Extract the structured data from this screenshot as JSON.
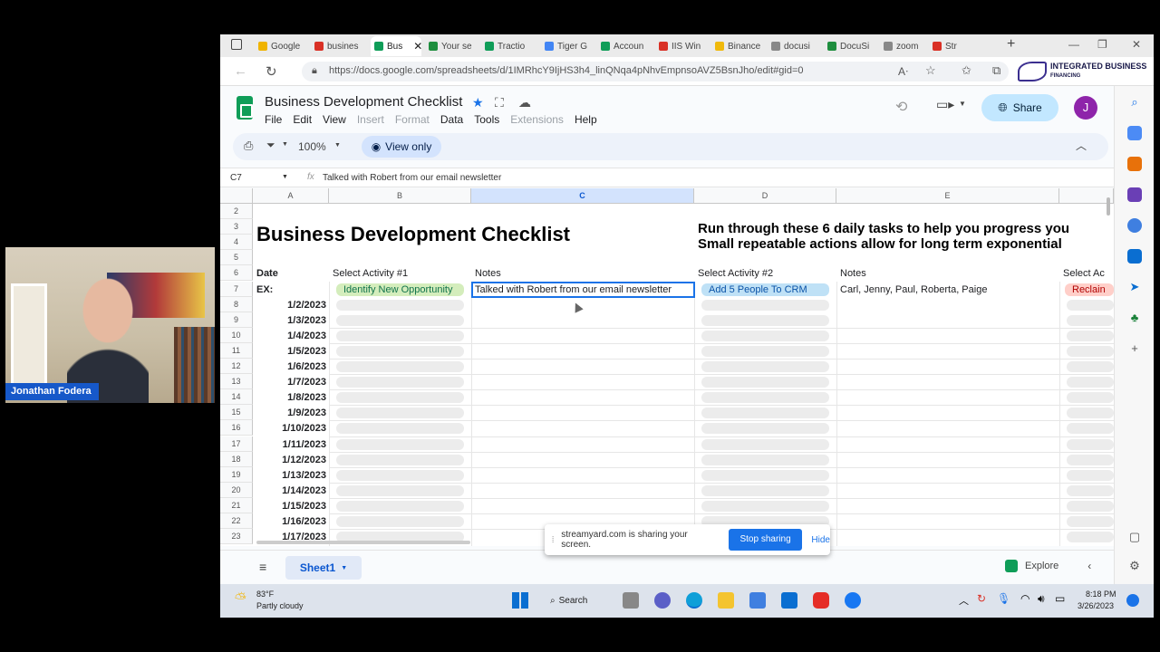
{
  "browser": {
    "tabs": [
      {
        "label": "Google",
        "color": "#f0b400"
      },
      {
        "label": "busines",
        "color": "#d93025"
      },
      {
        "label": "Bus",
        "color": "#0f9d58",
        "active": true
      },
      {
        "label": "Your se",
        "color": "#1e8e3e"
      },
      {
        "label": "Tractio",
        "color": "#0f9d58"
      },
      {
        "label": "Tiger G",
        "color": "#4285f4"
      },
      {
        "label": "Accoun",
        "color": "#0f9d58"
      },
      {
        "label": "IIS Win",
        "color": "#d93025"
      },
      {
        "label": "Binance",
        "color": "#f0b90b"
      },
      {
        "label": "docusi",
        "color": "#888888"
      },
      {
        "label": "DocuSi",
        "color": "#1e8e3e"
      },
      {
        "label": "zoom",
        "color": "#888888"
      },
      {
        "label": "Str",
        "color": "#d93025"
      }
    ],
    "url": "https://docs.google.com/spreadsheets/d/1IMRhcY9IjHS3h4_linQNqa4pNhvEmpnsoAVZ5BsnJho/edit#gid=0",
    "brand_line1": "INTEGRATED BUSINESS",
    "brand_line2": "FINANCING"
  },
  "sheets": {
    "doc_title": "Business Development Checklist",
    "menus": [
      "File",
      "Edit",
      "View",
      "Insert",
      "Format",
      "Data",
      "Tools",
      "Extensions",
      "Help"
    ],
    "share_label": "Share",
    "avatar_letter": "J",
    "zoom": "100%",
    "view_only_label": "View only",
    "cell_ref": "C7",
    "formula_icon": "fx",
    "formula_value": "Talked with Robert from our email newsletter",
    "columns": [
      "A",
      "B",
      "C",
      "D",
      "E"
    ],
    "rows": [
      "2",
      "3",
      "4",
      "5",
      "6",
      "7",
      "8",
      "9",
      "10",
      "11",
      "12",
      "13",
      "14",
      "15",
      "16",
      "17",
      "18",
      "19",
      "20",
      "21",
      "22",
      "23"
    ],
    "big_title": "Business Development Checklist",
    "tagline_1": "Run through these 6 daily tasks to help you progress you",
    "tagline_2": "Small repeatable actions allow for long term exponential",
    "header_row": {
      "date": "Date",
      "activity1": "Select Activity #1",
      "notes1": "Notes",
      "activity2": "Select Activity #2",
      "notes2": "Notes",
      "activity3": "Select Ac"
    },
    "example_row": {
      "label": "EX:",
      "activity1": "Identify New Opportunity",
      "notes1": "Talked with Robert from our email newsletter",
      "activity2": "Add 5 People To CRM",
      "notes2": "Carl, Jenny, Paul, Roberta, Paige",
      "activity3": "Reclain"
    },
    "dates": [
      "1/2/2023",
      "1/3/2023",
      "1/4/2023",
      "1/5/2023",
      "1/6/2023",
      "1/7/2023",
      "1/8/2023",
      "1/9/2023",
      "1/10/2023",
      "1/11/2023",
      "1/12/2023",
      "1/13/2023",
      "1/14/2023",
      "1/15/2023",
      "1/16/2023",
      "1/17/2023"
    ],
    "sheet_tab": "Sheet1",
    "explore_label": "Explore",
    "colors": {
      "chip_green": "#d4edbc",
      "chip_green_text": "#11734b",
      "chip_blue": "#bfe1f6",
      "chip_blue_text": "#0a53a8",
      "chip_red": "#ffcfc9",
      "chip_red_text": "#b10202"
    }
  },
  "share_popup": {
    "message": "streamyard.com is sharing your screen.",
    "stop_label": "Stop sharing",
    "hide_label": "Hide"
  },
  "taskbar": {
    "temp": "83°F",
    "weather": "Partly cloudy",
    "search_label": "Search",
    "time": "8:18 PM",
    "date": "3/26/2023"
  },
  "webcam": {
    "name": "Jonathan Fodera"
  }
}
